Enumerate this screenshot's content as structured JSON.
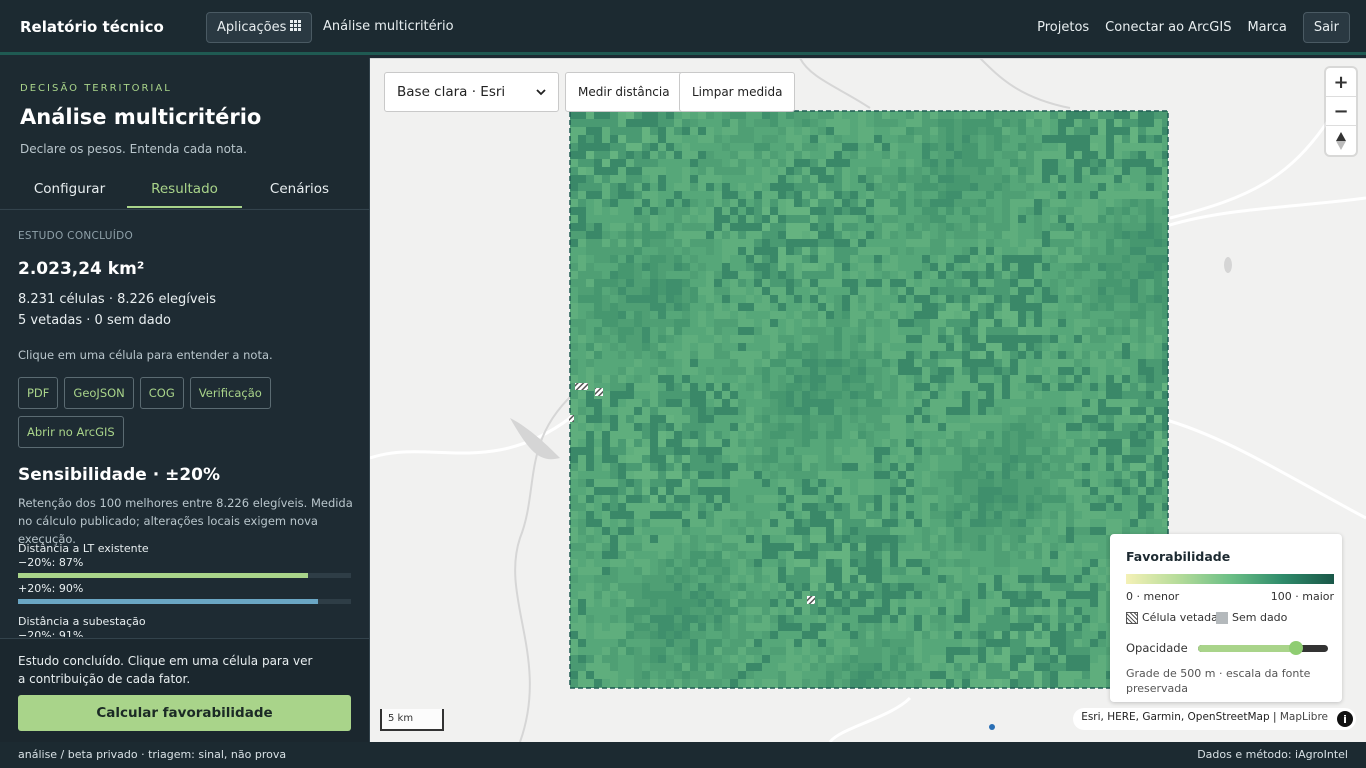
{
  "topbar": {
    "brand": "Relatório técnico",
    "apps_label": "Aplicações",
    "apps_icon": "grid-icon",
    "breadcrumb": "Análise multicritério",
    "nav": [
      "Projetos",
      "Conectar ao ArcGIS",
      "Marca"
    ],
    "logout_label": "Sair"
  },
  "sidebar": {
    "eyebrow": "DECISÃO TERRITORIAL",
    "title": "Análise multicritério",
    "subtitle": "Declare os pesos. Entenda cada nota.",
    "tabs": [
      {
        "label": "Configurar",
        "active": false
      },
      {
        "label": "Resultado",
        "active": true
      },
      {
        "label": "Cenários",
        "active": false
      }
    ],
    "status_label": "ESTUDO CONCLUÍDO",
    "area": "2.023,24 km²",
    "cells_line1": "8.231 células · 8.226 elegíveis",
    "cells_line2": "5 vetadas · 0 sem dado",
    "hint": "Clique em uma célula para entender a nota.",
    "export_buttons": [
      "PDF",
      "GeoJSON",
      "COG",
      "Verificação"
    ],
    "arcgis_button": "Abrir no ArcGIS",
    "sensitivity": {
      "title": "Sensibilidade · ±20%",
      "description": "Retenção dos 100 melhores entre 8.226 elegíveis. Medida no cálculo publicado; alterações locais exigem nova execução.",
      "factors": [
        {
          "name": "Distância a LT existente",
          "rows": [
            {
              "label": "−20%: 87%",
              "value": 87,
              "color": "#a9d48a"
            },
            {
              "label": "+20%: 90%",
              "value": 90,
              "color": "#6aa6c4"
            }
          ]
        },
        {
          "name": "Distância a subestação",
          "rows": [
            {
              "label": "−20%: 91%",
              "value": 91,
              "color": "#a9d48a"
            }
          ]
        }
      ]
    },
    "footer_message": "Estudo concluído. Clique em uma célula para ver a contribuição de cada fator.",
    "calc_button": "Calcular favorabilidade"
  },
  "statusbar": {
    "left": "análise / beta privado · triagem: sinal, não prova",
    "right": "Dados e método: iAgroIntel"
  },
  "map": {
    "basemap_selected": "Base clara · Esri",
    "measure_button": "Medir distância",
    "clear_button": "Limpar medida",
    "zoom_in": "+",
    "zoom_out": "−",
    "compass_icon": "compass-icon",
    "scale_label": "5 km",
    "attribution": "Esri, HERE, Garmin, OpenStreetMap | ",
    "attribution_link": "MapLibre",
    "attribution_icon": "info-icon"
  },
  "legend": {
    "title": "Favorabilidade",
    "min_label": "0 · menor",
    "max_label": "100 · maior",
    "vetoed_label": "Célula vetada",
    "nodata_label": "Sem dado",
    "opacity_label": "Opacidade",
    "opacity_value": 0.75,
    "note": "Grade de 500 m · escala da fonte preservada",
    "colors": [
      "#f4f1b6",
      "#b6dc9a",
      "#6cbf86",
      "#2f8c6b",
      "#1a5748"
    ]
  }
}
